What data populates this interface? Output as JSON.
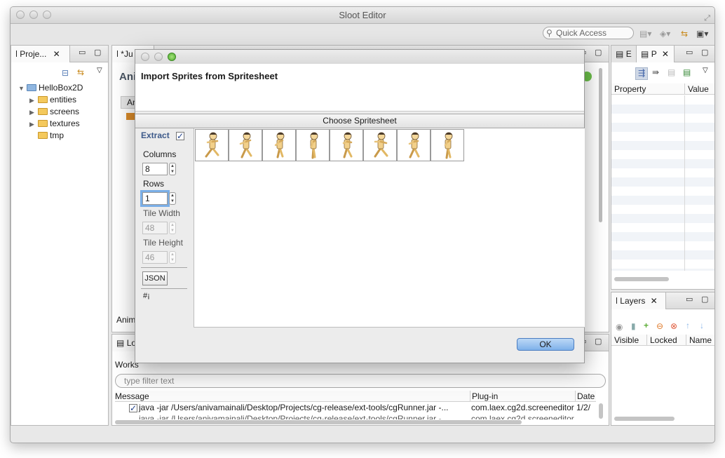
{
  "window": {
    "title": "Sloot Editor"
  },
  "toolbar": {
    "quick_access_placeholder": "Quick Access"
  },
  "project_panel": {
    "tab_label": "Proje...",
    "tree": [
      {
        "label": "HelloBox2D",
        "expanded": true,
        "level": 0
      },
      {
        "label": "entities",
        "expanded": false,
        "level": 1
      },
      {
        "label": "screens",
        "expanded": false,
        "level": 1
      },
      {
        "label": "textures",
        "expanded": false,
        "level": 1
      },
      {
        "label": "tmp",
        "expanded": null,
        "level": 1
      }
    ]
  },
  "editor": {
    "tab_label": "*Ju",
    "heading_fragment": "Ani",
    "subtab_fragment": "An",
    "footer_fragment": "Anim"
  },
  "log_panel": {
    "tab_label": "Lo",
    "workspace_fragment": "Works",
    "filter_placeholder": "type filter text",
    "columns": [
      "Message",
      "Plug-in",
      "Date"
    ],
    "rows": [
      {
        "checked": true,
        "message": "java -jar /Users/anivamainali/Desktop/Projects/cg-release/ext-tools/cgRunner.jar -...",
        "plugin": "com.laex.cg2d.screeneditor",
        "date": "1/2/"
      },
      {
        "checked": true,
        "message": "java -jar /Users/anivamainali/Desktop/Projects/cg-release/ext-tools/cgRunner.jar -...",
        "plugin": "com.laex.cg2d.screeneditor",
        "date": "1/2/"
      }
    ]
  },
  "properties_panel": {
    "tab_e": "E",
    "tab_p": "P",
    "columns": [
      "Property",
      "Value"
    ]
  },
  "layers_panel": {
    "tab_label": "Layers",
    "columns": [
      "Visible",
      "Locked",
      "Name"
    ]
  },
  "dialog": {
    "title": "Import Sprites from Spritesheet",
    "section": "Choose Spritesheet",
    "extract_label": "Extract",
    "extract_checked": true,
    "columns_label": "Columns",
    "columns_value": "8",
    "rows_label": "Rows",
    "rows_value": "1",
    "tile_width_label": "Tile Width",
    "tile_width_value": "48",
    "tile_height_label": "Tile Height",
    "tile_height_value": "46",
    "json_button": "JSON",
    "hash_label": "#¡",
    "ok_button": "OK",
    "frame_count": 8
  },
  "colors": {
    "selection_blue": "#7aaee6",
    "folder_yellow": "#f4c95d",
    "ok_button": "#7fb1ea"
  }
}
